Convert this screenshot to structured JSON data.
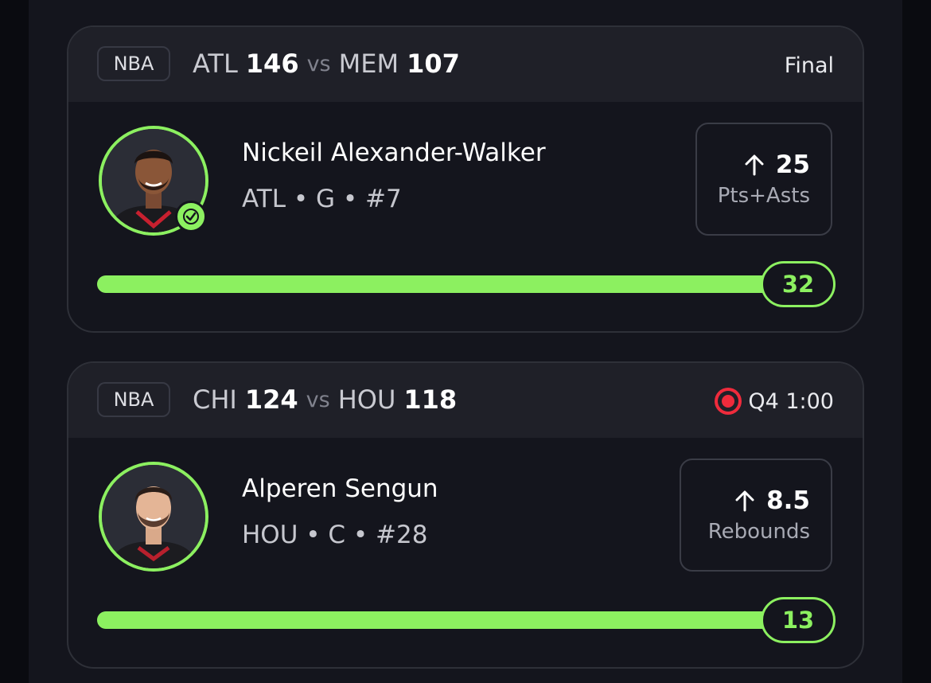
{
  "colors": {
    "accent": "#8cf060",
    "live": "#ef2b3c",
    "card_bg": "#14151d",
    "header_bg": "#1f2028"
  },
  "cards": [
    {
      "league": "NBA",
      "away_team": "ATL",
      "away_score": "146",
      "vs": "vs",
      "home_team": "MEM",
      "home_score": "107",
      "status": "Final",
      "live": false,
      "player": {
        "name": "Nickeil Alexander-Walker",
        "meta": "ATL • G • #7",
        "avatar_icon": "player-headshot",
        "hit": true
      },
      "prop": {
        "direction_icon": "arrow-up-icon",
        "line": "25",
        "stat": "Pts+Asts"
      },
      "progress": {
        "current": "32",
        "fraction": 1.0
      }
    },
    {
      "league": "NBA",
      "away_team": "CHI",
      "away_score": "124",
      "vs": "vs",
      "home_team": "HOU",
      "home_score": "118",
      "status": "Q4 1:00",
      "live": true,
      "player": {
        "name": "Alperen Sengun",
        "meta": "HOU • C • #28",
        "avatar_icon": "player-headshot",
        "hit": false
      },
      "prop": {
        "direction_icon": "arrow-up-icon",
        "line": "8.5",
        "stat": "Rebounds"
      },
      "progress": {
        "current": "13",
        "fraction": 1.0
      }
    }
  ]
}
